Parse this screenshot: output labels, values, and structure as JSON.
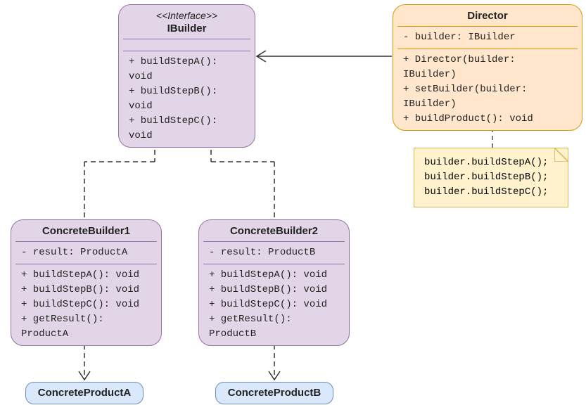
{
  "ibuilder": {
    "stereotype": "<<Interface>>",
    "name": "IBuilder",
    "methods": [
      "+ buildStepA(): void",
      "+ buildStepB(): void",
      "+ buildStepC(): void"
    ]
  },
  "director": {
    "name": "Director",
    "fields": [
      "- builder: IBuilder"
    ],
    "methods": [
      "+ Director(builder: IBuilder)",
      "+ setBuilder(builder: IBuilder)",
      "+ buildProduct(): void"
    ]
  },
  "note": {
    "lines": [
      "builder.buildStepA();",
      "builder.buildStepB();",
      "builder.buildStepC();"
    ]
  },
  "cb1": {
    "name": "ConcreteBuilder1",
    "fields": [
      "- result: ProductA"
    ],
    "methods": [
      "+ buildStepA(): void",
      "+ buildStepB(): void",
      "+ buildStepC(): void",
      "+ getResult(): ProductA"
    ]
  },
  "cb2": {
    "name": "ConcreteBuilder2",
    "fields": [
      "- result: ProductB"
    ],
    "methods": [
      "+ buildStepA(): void",
      "+ buildStepB(): void",
      "+ buildStepC(): void",
      "+ getResult(): ProductB"
    ]
  },
  "pa": {
    "name": "ConcreteProductA"
  },
  "pb": {
    "name": "ConcreteProductB"
  },
  "chart_data": {
    "type": "uml-class-diagram",
    "pattern": "Builder",
    "classes": [
      {
        "name": "IBuilder",
        "kind": "interface",
        "methods": [
          "buildStepA(): void",
          "buildStepB(): void",
          "buildStepC(): void"
        ]
      },
      {
        "name": "Director",
        "kind": "class",
        "fields": [
          "builder: IBuilder"
        ],
        "methods": [
          "Director(builder: IBuilder)",
          "setBuilder(builder: IBuilder)",
          "buildProduct(): void"
        ]
      },
      {
        "name": "ConcreteBuilder1",
        "kind": "class",
        "fields": [
          "result: ProductA"
        ],
        "methods": [
          "buildStepA(): void",
          "buildStepB(): void",
          "buildStepC(): void",
          "getResult(): ProductA"
        ]
      },
      {
        "name": "ConcreteBuilder2",
        "kind": "class",
        "fields": [
          "result: ProductB"
        ],
        "methods": [
          "buildStepA(): void",
          "buildStepB(): void",
          "buildStepC(): void",
          "getResult(): ProductB"
        ]
      },
      {
        "name": "ConcreteProductA",
        "kind": "class"
      },
      {
        "name": "ConcreteProductB",
        "kind": "class"
      }
    ],
    "relationships": [
      {
        "from": "Director",
        "to": "IBuilder",
        "type": "association"
      },
      {
        "from": "ConcreteBuilder1",
        "to": "IBuilder",
        "type": "realization"
      },
      {
        "from": "ConcreteBuilder2",
        "to": "IBuilder",
        "type": "realization"
      },
      {
        "from": "ConcreteBuilder1",
        "to": "ConcreteProductA",
        "type": "dependency"
      },
      {
        "from": "ConcreteBuilder2",
        "to": "ConcreteProductB",
        "type": "dependency"
      },
      {
        "from": "Director.buildProduct",
        "to": "note",
        "type": "note-link"
      }
    ],
    "note_body": [
      "builder.buildStepA();",
      "builder.buildStepB();",
      "builder.buildStepC();"
    ]
  }
}
